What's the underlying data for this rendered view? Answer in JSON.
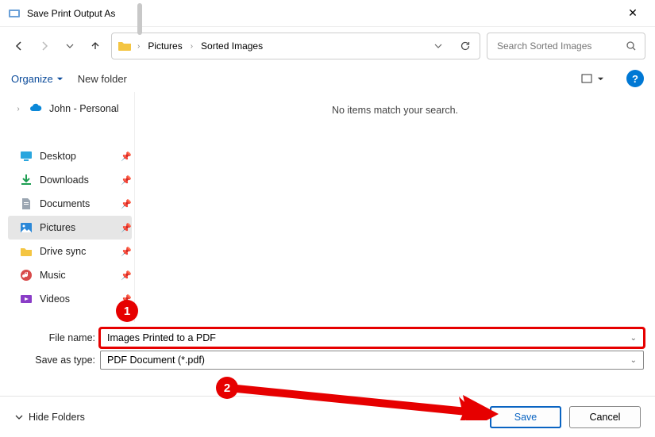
{
  "title": "Save Print Output As",
  "breadcrumbs": {
    "root": "Pictures",
    "current": "Sorted Images"
  },
  "search_placeholder": "Search Sorted Images",
  "toolbar": {
    "organize": "Organize",
    "newfolder": "New folder"
  },
  "tree": {
    "top": "John - Personal",
    "items": [
      {
        "label": "Desktop",
        "icon": "desktop"
      },
      {
        "label": "Downloads",
        "icon": "downloads"
      },
      {
        "label": "Documents",
        "icon": "documents"
      },
      {
        "label": "Pictures",
        "icon": "pictures",
        "selected": true
      },
      {
        "label": "Drive sync",
        "icon": "folder"
      },
      {
        "label": "Music",
        "icon": "music"
      },
      {
        "label": "Videos",
        "icon": "videos"
      }
    ]
  },
  "empty_message": "No items match your search.",
  "form": {
    "filename_label": "File name:",
    "filename_value": "Images Printed to a PDF",
    "saveas_label": "Save as type:",
    "saveas_value": "PDF Document (*.pdf)"
  },
  "buttons": {
    "hide_folders": "Hide Folders",
    "save": "Save",
    "cancel": "Cancel"
  },
  "annotations": {
    "step1": "1",
    "step2": "2"
  }
}
